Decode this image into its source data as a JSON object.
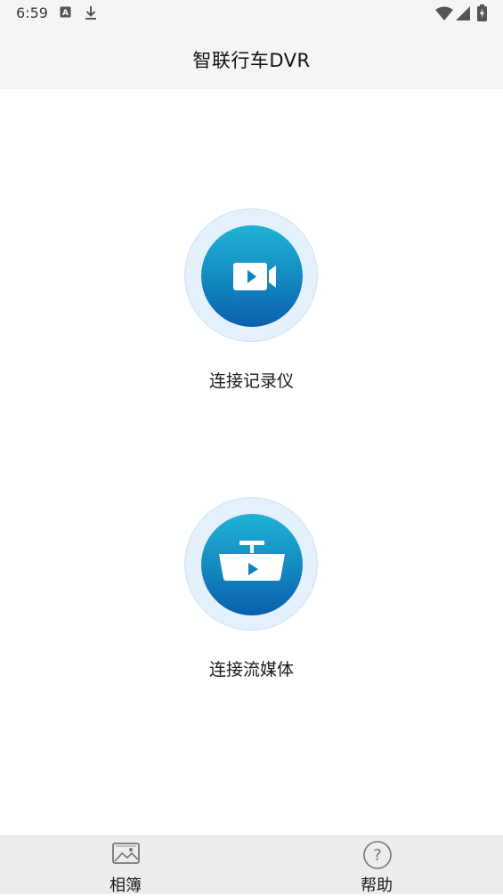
{
  "status_bar": {
    "time": "6:59",
    "icons": [
      "text-notification-icon",
      "download-icon",
      "wifi-icon",
      "cellular-signal-icon",
      "battery-charging-icon"
    ]
  },
  "header": {
    "title": "智联行车DVR"
  },
  "actions": [
    {
      "label": "连接记录仪",
      "icon": "video-camera-icon"
    },
    {
      "label": "连接流媒体",
      "icon": "rearview-mirror-play-icon"
    }
  ],
  "tabbar": {
    "items": [
      {
        "label": "相簿",
        "icon": "photo-album-icon"
      },
      {
        "label": "帮助",
        "icon": "help-icon"
      }
    ]
  },
  "colors": {
    "accent_top": "#21b2d6",
    "accent_bottom": "#0a5fad",
    "halo": "#e4f0fb",
    "header_bg": "#f5f5f5",
    "tabbar_bg": "#ededed"
  }
}
